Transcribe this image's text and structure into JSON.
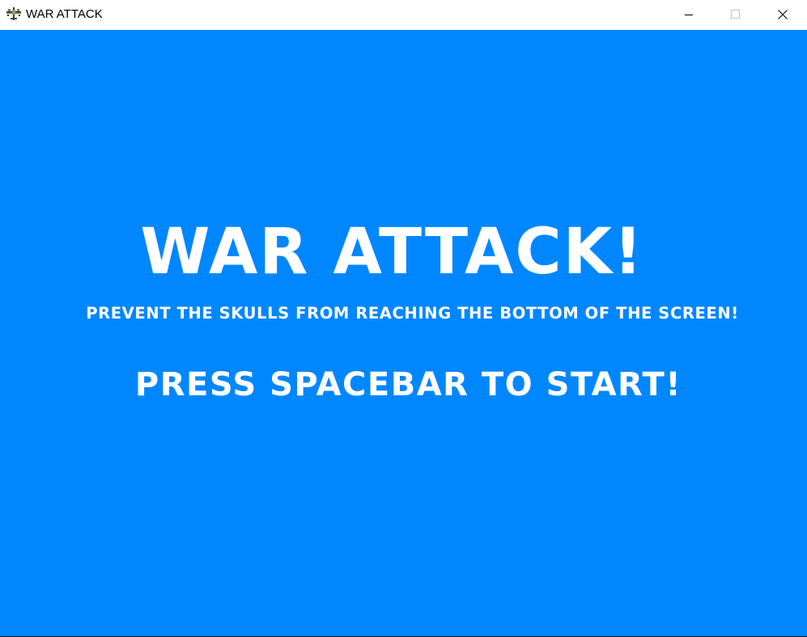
{
  "window": {
    "title": "WAR ATTACK",
    "app_icon": "plane-icon",
    "controls": {
      "minimize_icon": "minimize-icon",
      "maximize_icon": "maximize-icon",
      "close_icon": "close-icon"
    }
  },
  "game": {
    "background_color": "#0087ff",
    "text_color": "#ffffff",
    "title": "WAR ATTACK!",
    "instructions": "PREVENT THE SKULLS FROM REACHING THE BOTTOM OF THE SCREEN!",
    "start_prompt": "PRESS SPACEBAR TO START!"
  }
}
